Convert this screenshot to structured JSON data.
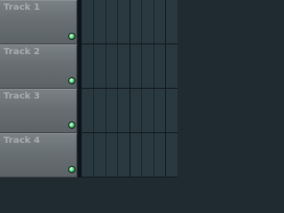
{
  "tracks": [
    {
      "label": "Track 1"
    },
    {
      "label": "Track 2"
    },
    {
      "label": "Track 3"
    },
    {
      "label": "Track 4"
    }
  ],
  "colors": {
    "led": "#3ddc72",
    "grid_background": "#2a3840",
    "track_header": "#686f73"
  },
  "icons": {
    "track_led": "green-led-icon"
  }
}
